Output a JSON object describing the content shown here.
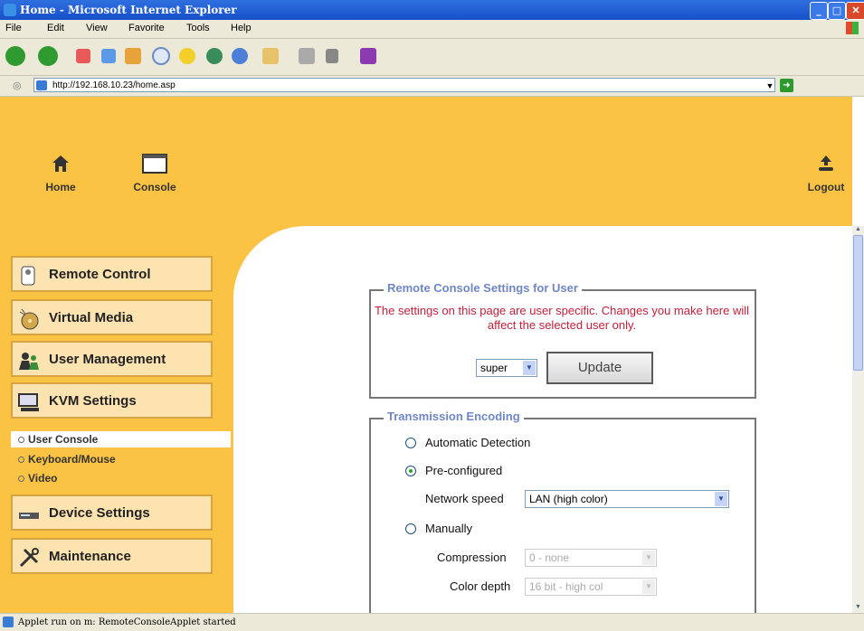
{
  "window": {
    "title": "Home - Microsoft Internet Explorer"
  },
  "menu": [
    "File",
    "Edit",
    "View",
    "Favorite",
    "Tools",
    "Help"
  ],
  "address": {
    "url": "http://192.168.10.23/home.asp"
  },
  "topnav": {
    "home": "Home",
    "console": "Console",
    "logout": "Logout"
  },
  "sidebar": {
    "items": [
      "Remote Control",
      "Virtual Media",
      "User Management",
      "KVM Settings",
      "Device Settings",
      "Maintenance"
    ],
    "subitems": [
      "User Console",
      "Keyboard/Mouse",
      "Video"
    ]
  },
  "user_settings": {
    "legend": "Remote Console Settings for User",
    "note": "The settings on this page are user specific. Changes you make here will affect the selected user only.",
    "user": "super",
    "update_label": "Update"
  },
  "encoding": {
    "legend": "Transmission Encoding",
    "auto_label": "Automatic Detection",
    "preconf_label": "Pre-configured",
    "speed_label": "Network speed",
    "speed_value": "LAN (high color)",
    "manual_label": "Manually",
    "compression_label": "Compression",
    "compression_value": "0 - none",
    "depth_label": "Color depth",
    "depth_value": "16 bit - high col",
    "selected": "preconfigured"
  },
  "status": {
    "text": "Applet run on m: RemoteConsoleApplet started"
  },
  "colors": {
    "page_bg": "#fbc344",
    "legend": "#6e87c4",
    "note": "#c2203a"
  }
}
